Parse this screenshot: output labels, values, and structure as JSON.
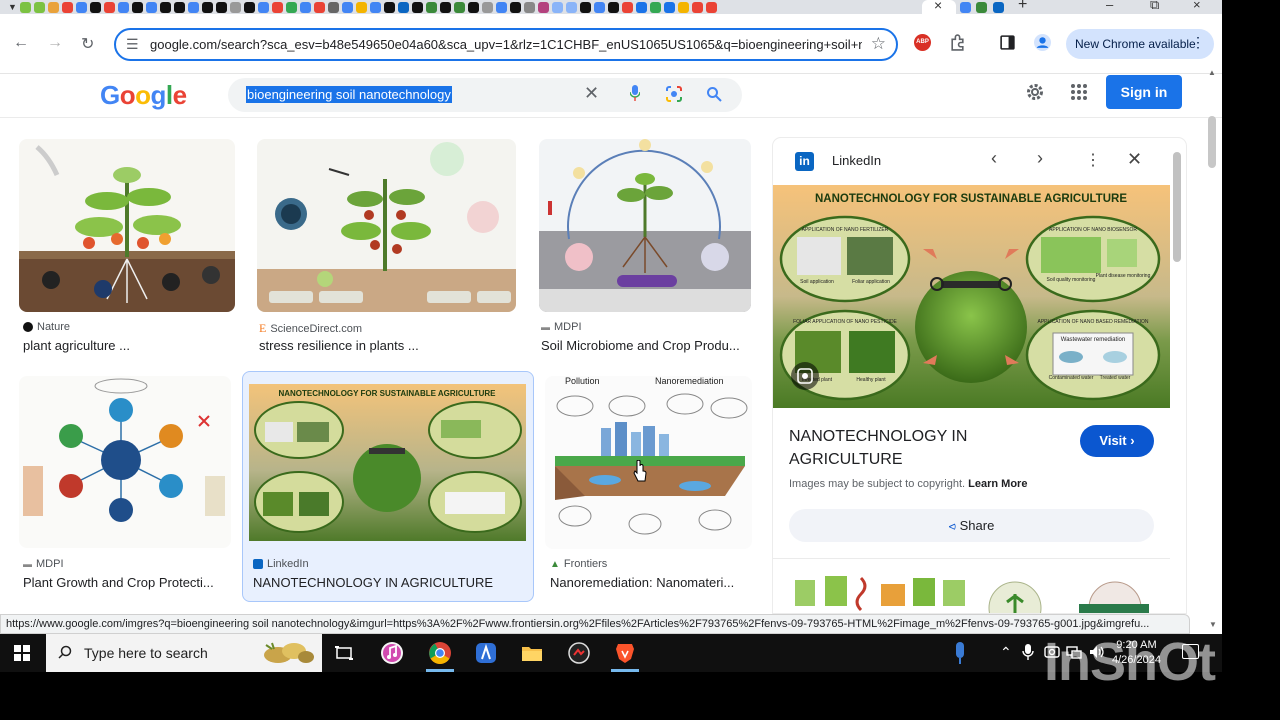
{
  "browser": {
    "url": "google.com/search?sca_esv=b48e549650e04a60&sca_upv=1&rlz=1C1CHBF_enUS1065US1065&q=bioengineering+soil+nanotechnology",
    "new_chrome_label": "New Chrome available"
  },
  "google": {
    "logo": [
      "G",
      "o",
      "o",
      "g",
      "l",
      "e"
    ],
    "query": "bioengineering soil nanotechnology",
    "sign_in": "Sign in"
  },
  "results": [
    {
      "source": "Nature",
      "caption": "plant agriculture ..."
    },
    {
      "source": "ScienceDirect.com",
      "caption": "stress resilience in plants ..."
    },
    {
      "source": "MDPI",
      "caption": "Soil Microbiome and Crop Produ..."
    },
    {
      "source": "MDPI",
      "caption": "Plant Growth and Crop Protecti..."
    },
    {
      "source": "LinkedIn",
      "caption": "NANOTECHNOLOGY IN AGRICULTURE"
    },
    {
      "source": "Frontiers",
      "caption": "Nanoremediation: Nanomateri..."
    }
  ],
  "thumb_text": {
    "pollution": "Pollution",
    "nanoremediation": "Nanoremediation",
    "nano_banner": "NANOTECHNOLOGY FOR SUSTAINABLE AGRICULTURE"
  },
  "panel": {
    "source": "LinkedIn",
    "image_banner": "NANOTECHNOLOGY FOR SUSTAINABLE AGRICULTURE",
    "image_labels": {
      "fertilizer": "APPLICATION OF NANO FERTILIZER",
      "biosensor": "APPLICATION OF NANO BIOSENSOR",
      "pesticide": "FOLIAR APPLICATION OF NANO PESTICIDE",
      "remediation": "APPLICATION OF NANO BASED REMEDIATION",
      "soil_application": "Soil application",
      "foliar_application": "Foliar application",
      "soil_quality": "Soil quality monitoring",
      "plant_disease": "Plant disease monitoring",
      "infected_plant": "Infected plant",
      "healthy_plant": "Healthy plant",
      "wastewater": "Wastewater remediation",
      "contaminated": "Contaminated water",
      "treated": "Treated water"
    },
    "title": "NANOTECHNOLOGY IN AGRICULTURE",
    "visit_label": "Visit",
    "copyright_text": "Images may be subject to copyright.",
    "learn_more": "Learn More",
    "share_label": "Share"
  },
  "status_url": "https://www.google.com/imgres?q=bioengineering soil nanotechnology&imgurl=https%3A%2F%2Fwww.frontiersin.org%2Ffiles%2FArticles%2F793765%2Ffenvs-09-793765-HTML%2Fimage_m%2Ffenvs-09-793765-g001.jpg&imgrefu...",
  "taskbar": {
    "search_placeholder": "Type here to search",
    "time": "9:20 AM",
    "date": "4/26/2024"
  },
  "watermark": "InShOt",
  "colors": {
    "accent": "#1a73e8",
    "linkedin": "#0a66c2",
    "visit_button": "#0b57d0"
  }
}
